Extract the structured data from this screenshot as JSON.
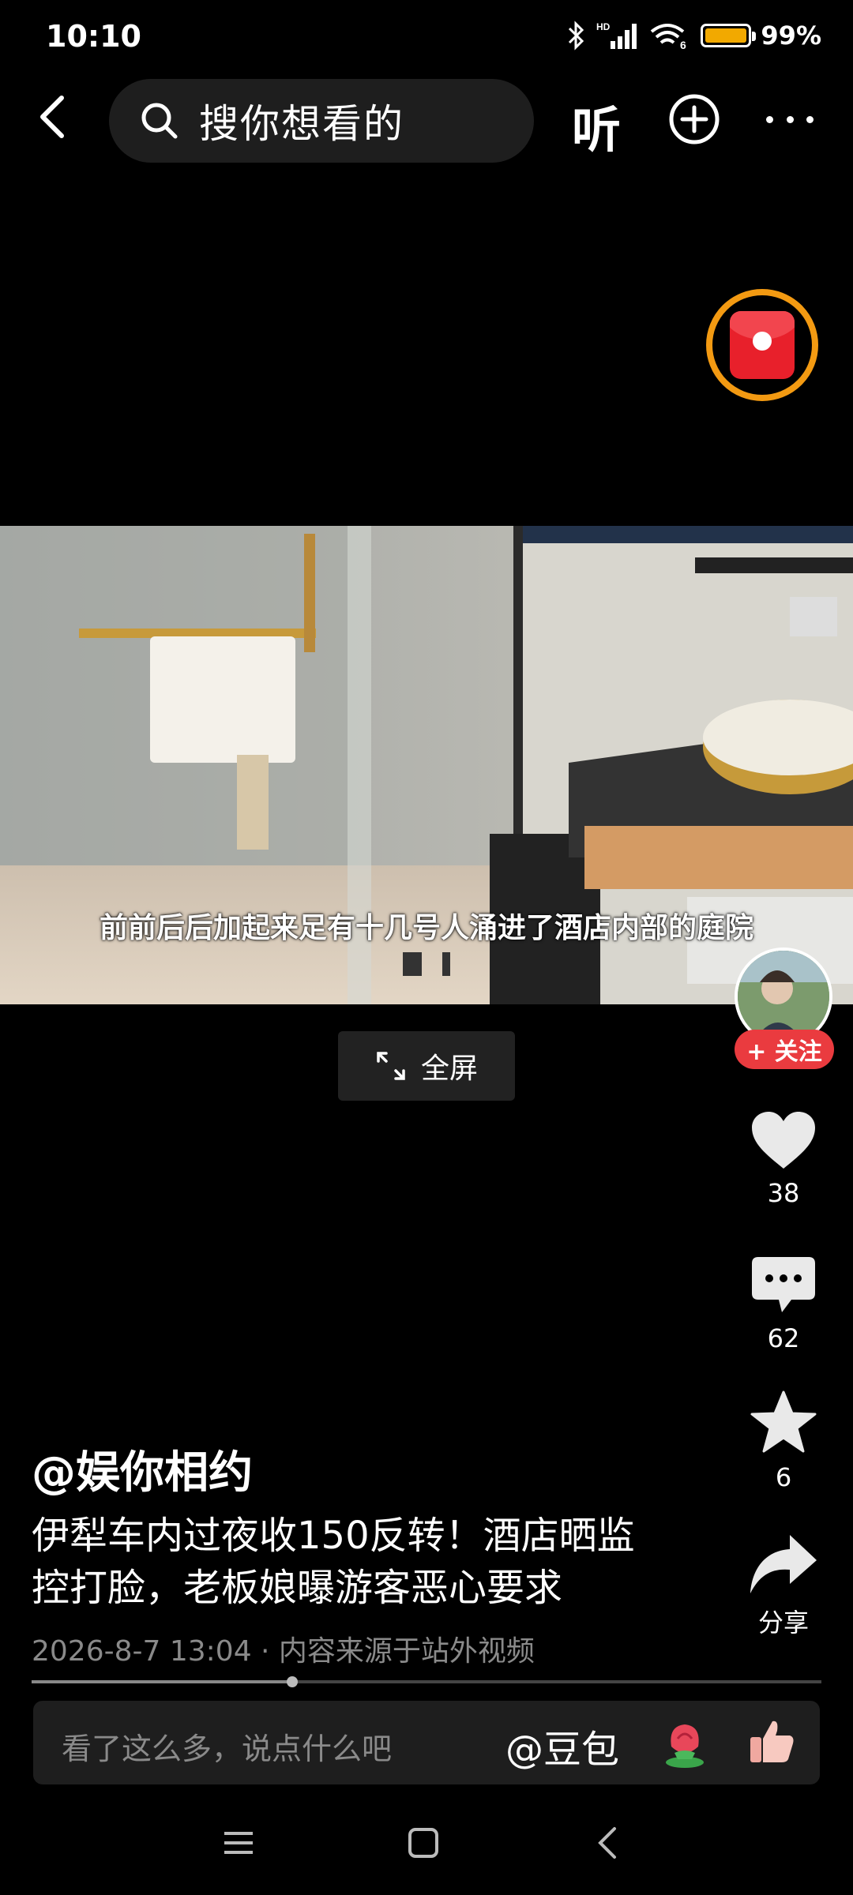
{
  "status_bar": {
    "time": "10:10",
    "battery_percent": 99,
    "battery_text": "99%",
    "icons": [
      "bluetooth-icon",
      "signal-icon",
      "wifi-icon",
      "battery-icon"
    ]
  },
  "top_nav": {
    "search_placeholder": "搜你想看的",
    "listen_label": "听"
  },
  "video": {
    "subtitle": "前前后后加起来足有十几号人涌进了酒店内部的庭院",
    "fullscreen_label": "全屏"
  },
  "actions": {
    "follow_label": "+ 关注",
    "like_count": "38",
    "comment_count": "62",
    "favorite_count": "6",
    "share_label": "分享"
  },
  "post": {
    "author": "@娱你相约",
    "title_line1": "伊犁车内过夜收150反转！酒店晒监",
    "title_line2": "控打脸，老板娘曝游客恶心要求",
    "meta": "2026-8-7 13:04 · 内容来源于站外视频",
    "progress_fraction": 0.33
  },
  "comment_bar": {
    "placeholder": "看了这么多，说点什么吧",
    "mention": "@豆包"
  },
  "colors": {
    "follow_red": "#ea3b3f",
    "redpacket_ring": "#f39a12",
    "battery": "#f2a900"
  }
}
